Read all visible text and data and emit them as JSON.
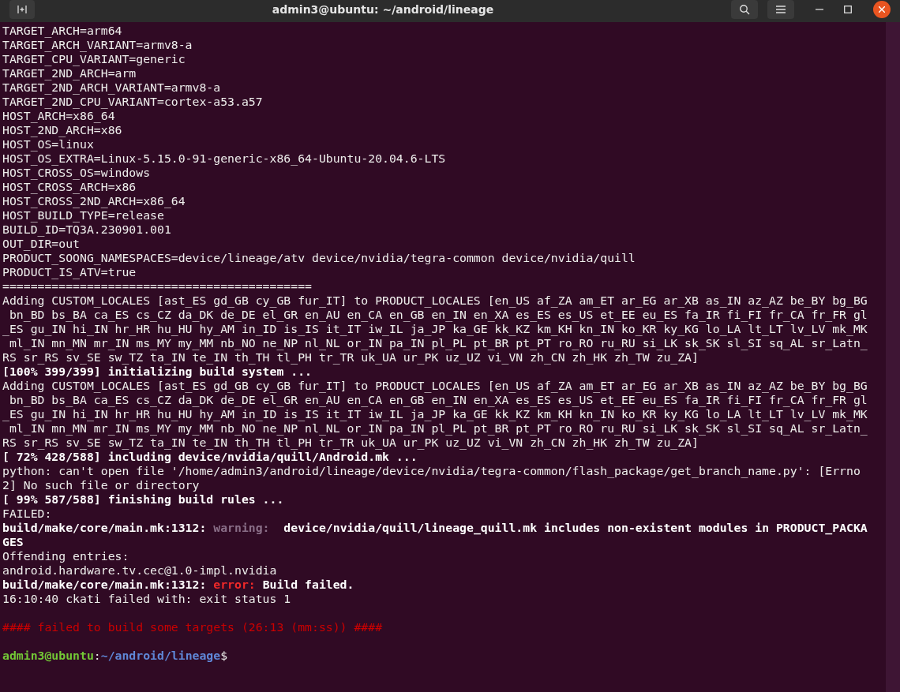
{
  "window": {
    "title": "admin3@ubuntu: ~/android/lineage"
  },
  "lines": [
    {
      "kind": "text",
      "segments": [
        {
          "text": "TARGET_ARCH=arm64",
          "kind": "plain"
        }
      ]
    },
    {
      "kind": "text",
      "segments": [
        {
          "text": "TARGET_ARCH_VARIANT=armv8-a",
          "kind": "plain"
        }
      ]
    },
    {
      "kind": "text",
      "segments": [
        {
          "text": "TARGET_CPU_VARIANT=generic",
          "kind": "plain"
        }
      ]
    },
    {
      "kind": "text",
      "segments": [
        {
          "text": "TARGET_2ND_ARCH=arm",
          "kind": "plain"
        }
      ]
    },
    {
      "kind": "text",
      "segments": [
        {
          "text": "TARGET_2ND_ARCH_VARIANT=armv8-a",
          "kind": "plain"
        }
      ]
    },
    {
      "kind": "text",
      "segments": [
        {
          "text": "TARGET_2ND_CPU_VARIANT=cortex-a53.a57",
          "kind": "plain"
        }
      ]
    },
    {
      "kind": "text",
      "segments": [
        {
          "text": "HOST_ARCH=x86_64",
          "kind": "plain"
        }
      ]
    },
    {
      "kind": "text",
      "segments": [
        {
          "text": "HOST_2ND_ARCH=x86",
          "kind": "plain"
        }
      ]
    },
    {
      "kind": "text",
      "segments": [
        {
          "text": "HOST_OS=linux",
          "kind": "plain"
        }
      ]
    },
    {
      "kind": "text",
      "segments": [
        {
          "text": "HOST_OS_EXTRA=Linux-5.15.0-91-generic-x86_64-Ubuntu-20.04.6-LTS",
          "kind": "plain"
        }
      ]
    },
    {
      "kind": "text",
      "segments": [
        {
          "text": "HOST_CROSS_OS=windows",
          "kind": "plain"
        }
      ]
    },
    {
      "kind": "text",
      "segments": [
        {
          "text": "HOST_CROSS_ARCH=x86",
          "kind": "plain"
        }
      ]
    },
    {
      "kind": "text",
      "segments": [
        {
          "text": "HOST_CROSS_2ND_ARCH=x86_64",
          "kind": "plain"
        }
      ]
    },
    {
      "kind": "text",
      "segments": [
        {
          "text": "HOST_BUILD_TYPE=release",
          "kind": "plain"
        }
      ]
    },
    {
      "kind": "text",
      "segments": [
        {
          "text": "BUILD_ID=TQ3A.230901.001",
          "kind": "plain"
        }
      ]
    },
    {
      "kind": "text",
      "segments": [
        {
          "text": "OUT_DIR=out",
          "kind": "plain"
        }
      ]
    },
    {
      "kind": "text",
      "segments": [
        {
          "text": "PRODUCT_SOONG_NAMESPACES=device/lineage/atv device/nvidia/tegra-common device/nvidia/quill",
          "kind": "plain"
        }
      ]
    },
    {
      "kind": "text",
      "segments": [
        {
          "text": "PRODUCT_IS_ATV=true",
          "kind": "plain"
        }
      ]
    },
    {
      "kind": "text",
      "segments": [
        {
          "text": "============================================",
          "kind": "plain"
        }
      ]
    },
    {
      "kind": "text",
      "segments": [
        {
          "text": "Adding CUSTOM_LOCALES [ast_ES gd_GB cy_GB fur_IT] to PRODUCT_LOCALES [en_US af_ZA am_ET ar_EG ar_XB as_IN az_AZ be_BY bg_BG",
          "kind": "plain"
        }
      ]
    },
    {
      "kind": "text",
      "segments": [
        {
          "text": " bn_BD bs_BA ca_ES cs_CZ da_DK de_DE el_GR en_AU en_CA en_GB en_IN en_XA es_ES es_US et_EE eu_ES fa_IR fi_FI fr_CA fr_FR gl",
          "kind": "plain"
        }
      ]
    },
    {
      "kind": "text",
      "segments": [
        {
          "text": "_ES gu_IN hi_IN hr_HR hu_HU hy_AM in_ID is_IS it_IT iw_IL ja_JP ka_GE kk_KZ km_KH kn_IN ko_KR ky_KG lo_LA lt_LT lv_LV mk_MK",
          "kind": "plain"
        }
      ]
    },
    {
      "kind": "text",
      "segments": [
        {
          "text": " ml_IN mn_MN mr_IN ms_MY my_MM nb_NO ne_NP nl_NL or_IN pa_IN pl_PL pt_BR pt_PT ro_RO ru_RU si_LK sk_SK sl_SI sq_AL sr_Latn_",
          "kind": "plain"
        }
      ]
    },
    {
      "kind": "text",
      "segments": [
        {
          "text": "RS sr_RS sv_SE sw_TZ ta_IN te_IN th_TH tl_PH tr_TR uk_UA ur_PK uz_UZ vi_VN zh_CN zh_HK zh_TW zu_ZA]",
          "kind": "plain"
        }
      ]
    },
    {
      "kind": "text",
      "segments": [
        {
          "text": "[100% 399/399] initializing build system ...",
          "kind": "bold"
        }
      ]
    },
    {
      "kind": "text",
      "segments": [
        {
          "text": "Adding CUSTOM_LOCALES [ast_ES gd_GB cy_GB fur_IT] to PRODUCT_LOCALES [en_US af_ZA am_ET ar_EG ar_XB as_IN az_AZ be_BY bg_BG",
          "kind": "plain"
        }
      ]
    },
    {
      "kind": "text",
      "segments": [
        {
          "text": " bn_BD bs_BA ca_ES cs_CZ da_DK de_DE el_GR en_AU en_CA en_GB en_IN en_XA es_ES es_US et_EE eu_ES fa_IR fi_FI fr_CA fr_FR gl",
          "kind": "plain"
        }
      ]
    },
    {
      "kind": "text",
      "segments": [
        {
          "text": "_ES gu_IN hi_IN hr_HR hu_HU hy_AM in_ID is_IS it_IT iw_IL ja_JP ka_GE kk_KZ km_KH kn_IN ko_KR ky_KG lo_LA lt_LT lv_LV mk_MK",
          "kind": "plain"
        }
      ]
    },
    {
      "kind": "text",
      "segments": [
        {
          "text": " ml_IN mn_MN mr_IN ms_MY my_MM nb_NO ne_NP nl_NL or_IN pa_IN pl_PL pt_BR pt_PT ro_RO ru_RU si_LK sk_SK sl_SI sq_AL sr_Latn_",
          "kind": "plain"
        }
      ]
    },
    {
      "kind": "text",
      "segments": [
        {
          "text": "RS sr_RS sv_SE sw_TZ ta_IN te_IN th_TH tl_PH tr_TR uk_UA ur_PK uz_UZ vi_VN zh_CN zh_HK zh_TW zu_ZA]",
          "kind": "plain"
        }
      ]
    },
    {
      "kind": "text",
      "segments": [
        {
          "text": "[ 72% 428/588] including device/nvidia/quill/Android.mk ...",
          "kind": "bold"
        }
      ]
    },
    {
      "kind": "text",
      "segments": [
        {
          "text": "python: can't open file '/home/admin3/android/lineage/device/nvidia/tegra-common/flash_package/get_branch_name.py': [Errno",
          "kind": "plain"
        }
      ]
    },
    {
      "kind": "text",
      "segments": [
        {
          "text": "2] No such file or directory",
          "kind": "plain"
        }
      ]
    },
    {
      "kind": "text",
      "segments": [
        {
          "text": "[ 99% 587/588] finishing build rules ...",
          "kind": "bold"
        }
      ]
    },
    {
      "kind": "text",
      "segments": [
        {
          "text": "FAILED:",
          "kind": "plain"
        }
      ]
    },
    {
      "kind": "text",
      "segments": [
        {
          "text": "build/make/core/main.mk:1312: ",
          "kind": "bold"
        },
        {
          "text": "warning:",
          "kind": "warning"
        },
        {
          "text": "  device/nvidia/quill/lineage_quill.mk includes non-existent modules in PRODUCT_PACKA",
          "kind": "bold"
        }
      ]
    },
    {
      "kind": "text",
      "segments": [
        {
          "text": "GES",
          "kind": "bold"
        }
      ]
    },
    {
      "kind": "text",
      "segments": [
        {
          "text": "Offending entries:",
          "kind": "plain"
        }
      ]
    },
    {
      "kind": "text",
      "segments": [
        {
          "text": "android.hardware.tv.cec@1.0-impl.nvidia",
          "kind": "plain"
        }
      ]
    },
    {
      "kind": "text",
      "segments": [
        {
          "text": "build/make/core/main.mk:1312: ",
          "kind": "bold"
        },
        {
          "text": "error:",
          "kind": "error"
        },
        {
          "text": " Build failed.",
          "kind": "bold"
        }
      ]
    },
    {
      "kind": "text",
      "segments": [
        {
          "text": "16:10:40 ckati failed with: exit status 1",
          "kind": "plain"
        }
      ]
    },
    {
      "kind": "blank"
    },
    {
      "kind": "text",
      "segments": [
        {
          "text": "#### failed to build some targets (26:13 (mm:ss)) ####",
          "kind": "red"
        }
      ]
    },
    {
      "kind": "blank"
    },
    {
      "kind": "text",
      "segments": [
        {
          "text": "admin3@ubuntu",
          "kind": "user"
        },
        {
          "text": ":",
          "kind": "plain"
        },
        {
          "text": "~/android/lineage",
          "kind": "path"
        },
        {
          "text": "$",
          "kind": "plain"
        }
      ]
    }
  ]
}
